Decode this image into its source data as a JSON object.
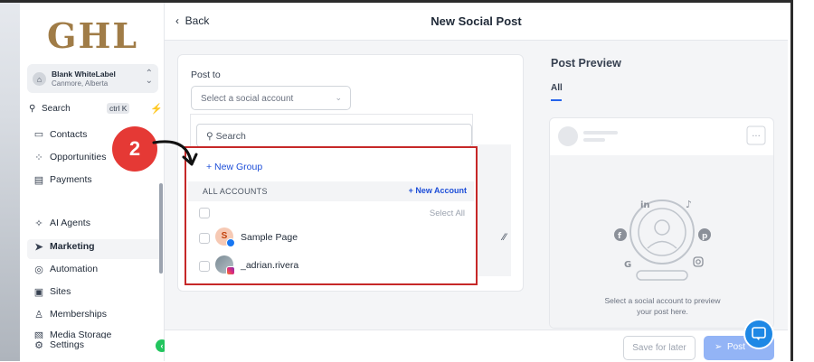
{
  "sidebar": {
    "logo": "GHL",
    "account": {
      "name": "Blank WhiteLabel",
      "location": "Canmore, Alberta"
    },
    "search": {
      "label": "Search",
      "shortcut": "ctrl K"
    },
    "items": [
      {
        "label": "Contacts"
      },
      {
        "label": "Opportunities"
      },
      {
        "label": "Payments"
      },
      {
        "label": "AI Agents"
      },
      {
        "label": "Marketing"
      },
      {
        "label": "Automation"
      },
      {
        "label": "Sites"
      },
      {
        "label": "Memberships"
      },
      {
        "label": "Media Storage"
      },
      {
        "label": "Settings"
      }
    ],
    "active_item": "Marketing"
  },
  "header": {
    "back_label": "Back",
    "title": "New Social Post"
  },
  "composer": {
    "post_to_label": "Post to",
    "select_placeholder": "Select a social account",
    "search_placeholder": "Search",
    "new_group_label": "+ New Group",
    "all_accounts_label": "ALL ACCOUNTS",
    "new_account_label": "+ New Account",
    "select_all_label": "Select All",
    "accounts": [
      {
        "name": "Sample Page",
        "network": "facebook",
        "avatar_letter": "S"
      },
      {
        "name": "_adrian.rivera",
        "network": "instagram",
        "avatar_letter": ""
      }
    ]
  },
  "annotation": {
    "step_number": "2",
    "color": "#e53935"
  },
  "preview": {
    "title": "Post Preview",
    "tab_all": "All",
    "message_line1": "Select a social account to preview",
    "message_line2": "your post here."
  },
  "footer": {
    "save_later_label": "Save for later",
    "post_label": "Post"
  },
  "colors": {
    "accent": "#2563eb",
    "highlight_border": "#c62828",
    "logo": "#a07c47"
  }
}
